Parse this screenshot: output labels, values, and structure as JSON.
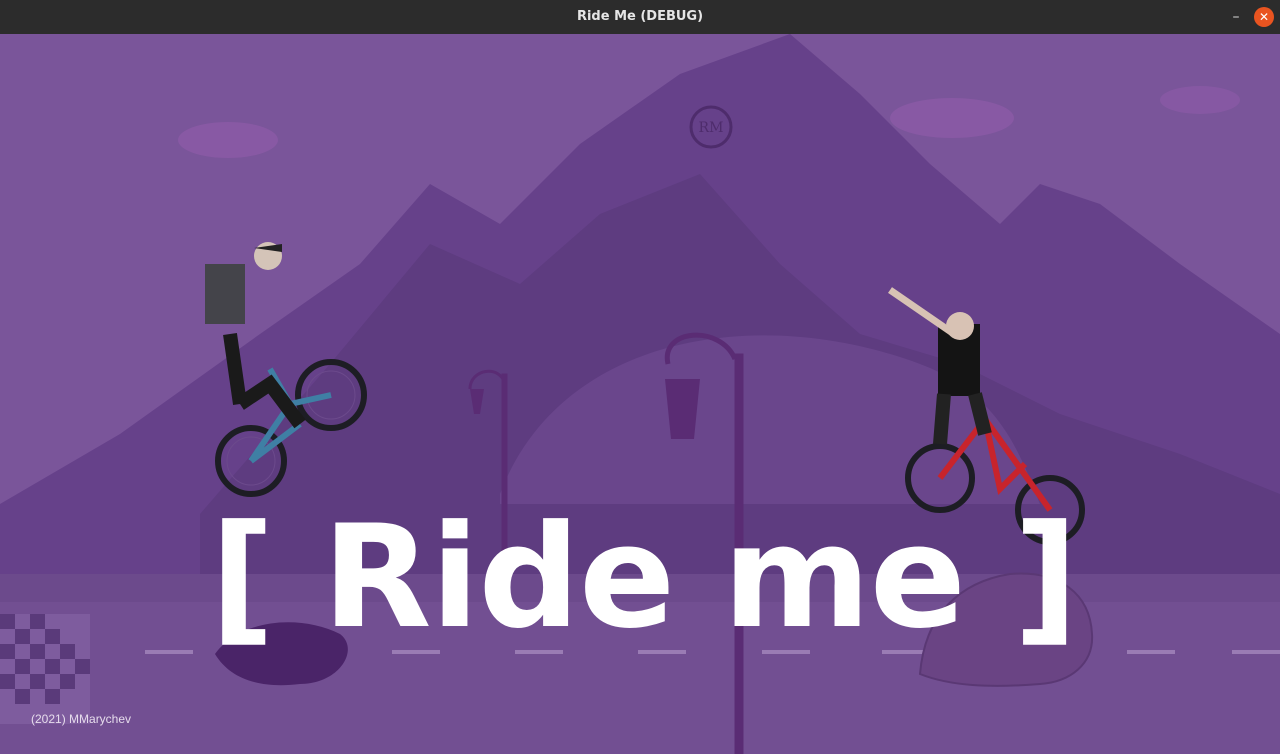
{
  "window": {
    "title": "Ride Me (DEBUG)",
    "minimize_glyph": "–",
    "close_glyph": "✕",
    "close_color": "#e95420"
  },
  "game": {
    "logo_text": "[ Ride me ]",
    "credit": "(2021) MMarychev",
    "emblem_text": "RM",
    "background_color": "#704a8e",
    "sky_color": "#7c569a",
    "mountain_color": "#5e3a7c",
    "ground_color": "#6a4a8a",
    "left_bike_color": "#3f7fa4",
    "right_bike_color": "#c8242c"
  }
}
